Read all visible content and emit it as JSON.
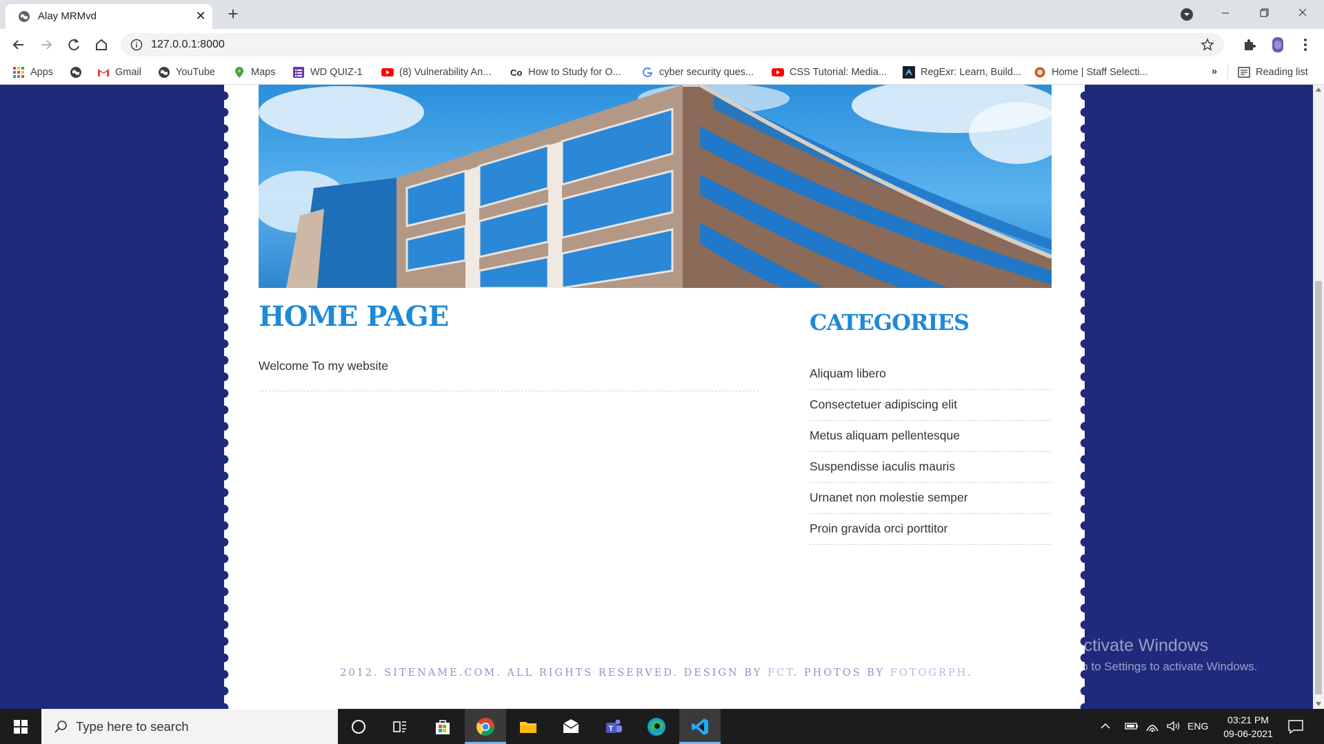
{
  "browser": {
    "tab_title": "Alay MRMvd",
    "url": "127.0.0.1:8000",
    "bookmarks": [
      {
        "label": "Apps",
        "icon": "apps-grid-icon"
      },
      {
        "label": "",
        "icon": "globe-icon"
      },
      {
        "label": "Gmail",
        "icon": "gmail-icon"
      },
      {
        "label": "YouTube",
        "icon": "globe-icon"
      },
      {
        "label": "Maps",
        "icon": "maps-pin-icon"
      },
      {
        "label": "WD QUIZ-1",
        "icon": "forms-icon"
      },
      {
        "label": "(8) Vulnerability An...",
        "icon": "youtube-icon"
      },
      {
        "label": "How to Study for O...",
        "icon": "co-icon"
      },
      {
        "label": "cyber security ques...",
        "icon": "google-icon"
      },
      {
        "label": "CSS Tutorial: Media...",
        "icon": "youtube-icon"
      },
      {
        "label": "RegExr: Learn, Build...",
        "icon": "regexr-icon"
      },
      {
        "label": "Home | Staff Selecti...",
        "icon": "emblem-icon"
      }
    ],
    "more_label": "»",
    "reading_list": "Reading list"
  },
  "page": {
    "home_title": "HOME PAGE",
    "welcome": "Welcome To my website",
    "categories_title": "CATEGORIES",
    "categories": [
      "Aliquam libero",
      "Consectetuer adipiscing elit",
      "Metus aliquam pellentesque",
      "Suspendisse iaculis mauris",
      "Urnanet non molestie semper",
      "Proin gravida orci porttitor"
    ],
    "footer": {
      "text1": "2012. SITENAME.COM. ALL RIGHTS RESERVED. DESIGN BY ",
      "link1": "FCT",
      "text2": ". PHOTOS BY ",
      "link2": "FOTOGRPH",
      "text3": "."
    }
  },
  "watermark": {
    "line1": "Activate Windows",
    "line2": "Go to Settings to activate Windows."
  },
  "taskbar": {
    "search_placeholder": "Type here to search",
    "language": "ENG",
    "time": "03:21 PM",
    "date": "09-06-2021"
  },
  "colors": {
    "page_background": "#1f2a7c",
    "heading_blue": "#1e8ad6"
  }
}
